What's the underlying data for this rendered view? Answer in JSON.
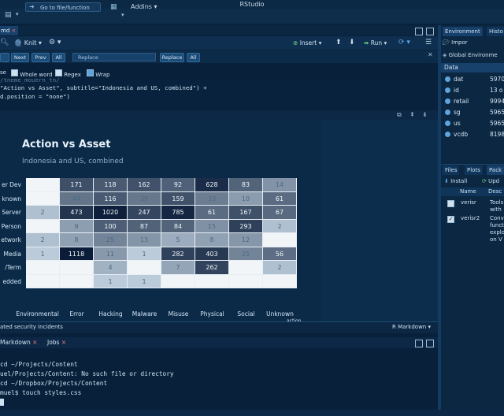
{
  "app": {
    "title": "RStudio"
  },
  "toolbar": {
    "goto_label": "Go to file/function",
    "addins_label": "Addins"
  },
  "editor": {
    "tab_label": "md",
    "knit_label": "Knit",
    "insert_label": "Insert",
    "run_label": "Run",
    "find": {
      "next": "Next",
      "prev": "Prev",
      "all": "All",
      "replace_placeholder": "Replace",
      "replace_btn": "Replace",
      "replace_all": "All"
    },
    "options": {
      "case": "se",
      "whole_word": "Whole word",
      "regex": "Regex",
      "wrap": "Wrap"
    },
    "code_lines": [
      "\"Action vs Asset\", subtitle=\"Indonesia and US, combined\") +",
      "d.position = \"none\")"
    ],
    "status_left": "ated security incidents",
    "status_right": "R Markdown"
  },
  "chart_data": {
    "type": "heatmap",
    "title": "Action vs Asset",
    "subtitle": "Indonesia and US, combined",
    "categories_x": [
      "Environmental",
      "Error",
      "Hacking",
      "Malware",
      "Misuse",
      "Physical",
      "Social",
      "Unknown"
    ],
    "categories_y": [
      "er Dev",
      "known",
      "Server",
      "Person",
      "etwork",
      "Media",
      "/Term",
      "edded"
    ],
    "values": [
      [
        "",
        "171",
        "118",
        "162",
        "92",
        "628",
        "83",
        "14"
      ],
      [
        "",
        "44",
        "116",
        "39",
        "159",
        "33",
        "10",
        "61"
      ],
      [
        "2",
        "473",
        "1020",
        "247",
        "785",
        "61",
        "167",
        "67"
      ],
      [
        "",
        "9",
        "100",
        "87",
        "84",
        "15",
        "293",
        "2"
      ],
      [
        "2",
        "8",
        "25",
        "13",
        "5",
        "8",
        "12",
        ""
      ],
      [
        "1",
        "1118",
        "11",
        "1",
        "282",
        "403",
        "25",
        "56"
      ],
      [
        "",
        "",
        "4",
        "",
        "7",
        "262",
        "",
        "2"
      ],
      [
        "",
        "",
        "1",
        "1",
        "",
        "",
        "",
        ""
      ]
    ],
    "x_axis_suffix": "action"
  },
  "console": {
    "tabs": [
      "Markdown",
      "Jobs"
    ],
    "lines": [
      "cd ~/Projects/Content",
      "uel/Projects/Content: No such file or directory",
      "cd ~/Dropbox/Projects/Content",
      "muel$ touch styles.css"
    ]
  },
  "env": {
    "tabs": [
      "Environment",
      "Histo"
    ],
    "import_label": "Impor",
    "global_label": "Global Environme",
    "section": "Data",
    "rows": [
      {
        "name": "dat",
        "val": "5970"
      },
      {
        "name": "id",
        "val": "13 o"
      },
      {
        "name": "retail",
        "val": "9994"
      },
      {
        "name": "sg",
        "val": "5965"
      },
      {
        "name": "us",
        "val": "5965"
      },
      {
        "name": "vcdb",
        "val": "8198"
      }
    ]
  },
  "packages": {
    "tabs": [
      "Files",
      "Plots",
      "Pack"
    ],
    "install_label": "Install",
    "update_label": "Upd",
    "col_name": "Name",
    "col_desc": "Desc",
    "rows": [
      {
        "name": "verisr",
        "desc": "Tools with",
        "checked": false
      },
      {
        "name": "verisr2",
        "desc": "Conv funct explo on V",
        "checked": true
      }
    ]
  }
}
